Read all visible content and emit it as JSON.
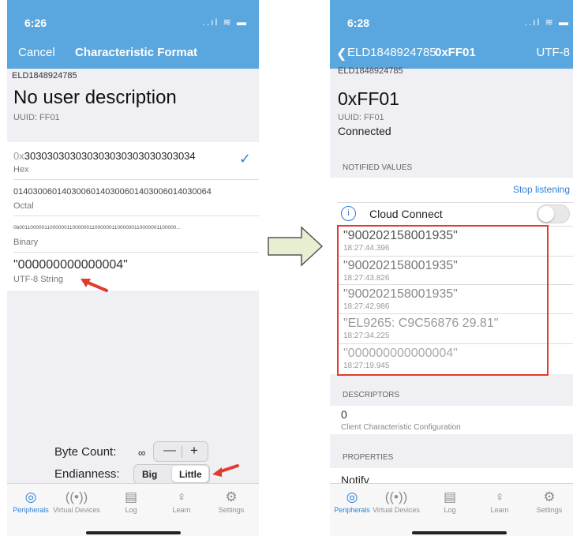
{
  "left": {
    "status": {
      "time": "6:26",
      "icons": "..ıl ≋ ▬"
    },
    "nav": {
      "cancel": "Cancel",
      "title": "Characteristic Format"
    },
    "device_name": "ELD1848924785",
    "description": "No user description",
    "uuid": "UUID: FF01",
    "formats": [
      {
        "prefix": "0x",
        "value": "303030303030303030303030303034",
        "label": "Hex",
        "selected": true
      },
      {
        "prefix": "",
        "value": "01403006014030060140300601403006014030064",
        "label": "Octal"
      },
      {
        "prefix": "",
        "value": "0b00110000011000000110000001100000011000000110000001100000...",
        "label": "Binary"
      },
      {
        "prefix": "",
        "value": "\"000000000000004\"",
        "label": "UTF-8 String"
      }
    ],
    "byte_count": {
      "label": "Byte Count:",
      "value": "∞",
      "minus": "—",
      "plus": "+"
    },
    "endianness": {
      "label": "Endianness:",
      "big": "Big",
      "little": "Little",
      "selected": "Little"
    }
  },
  "right": {
    "status": {
      "time": "6:28",
      "icons": "..ıl ≋ ▬"
    },
    "nav": {
      "back": "ELD1848924785",
      "title": "0xFF01",
      "format": "UTF-8"
    },
    "top_cut": "ELD1848924785",
    "char_name": "0xFF01",
    "uuid": "UUID: FF01",
    "connection": "Connected",
    "notified_header": "NOTIFIED VALUES",
    "stop_listening": "Stop listening",
    "cloud": {
      "icon": "i",
      "label": "Cloud Connect"
    },
    "values": [
      {
        "value": "\"900202158001935\"",
        "time": "18:27:44.396"
      },
      {
        "value": "\"900202158001935\"",
        "time": "18:27:43.826"
      },
      {
        "value": "\"900202158001935\"",
        "time": "18:27:42.986"
      },
      {
        "value": "\"EL9265: C9C56876 29.81\"",
        "time": "18:27:34.225"
      },
      {
        "value": "\"000000000000004\"",
        "time": "18:27:19.945"
      }
    ],
    "descriptors_header": "DESCRIPTORS",
    "descriptor": {
      "value": "0",
      "label": "Client Characteristic Configuration"
    },
    "properties_header": "PROPERTIES",
    "property": "Notify"
  },
  "tabs": [
    {
      "label": "Peripherals",
      "icon": "◎"
    },
    {
      "label": "Virtual Devices",
      "icon": "((•))"
    },
    {
      "label": "Log",
      "icon": "▤"
    },
    {
      "label": "Learn",
      "icon": "♀"
    },
    {
      "label": "Settings",
      "icon": "⚙"
    }
  ],
  "colors": {
    "nav": "#5aa7e0",
    "accent": "#2e7fd4",
    "highlight": "#e23b2e",
    "arrow_fill": "#e6efd2"
  }
}
